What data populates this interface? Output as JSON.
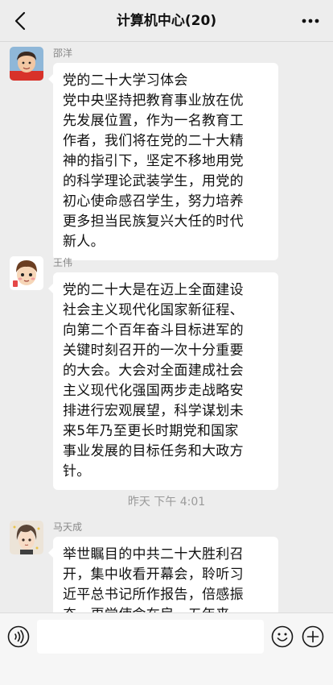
{
  "header": {
    "title": "计算机中心(20)",
    "back_icon": "chevron-left-icon",
    "more_icon": "more-dots-icon"
  },
  "messages": [
    {
      "sender": "邵洋",
      "avatar": "child-photo-avatar",
      "lines": [
        "党的二十大学习体会",
        "党中央坚持把教育事业放在优",
        "先发展位置，作为一名教育工",
        "作者，我们将在党的二十大精",
        "神的指引下，坚定不移地用党",
        "的科学理论武装学生，用党的",
        "初心使命感召学生，努力培养",
        "更多担当民族复兴大任的时代",
        "新人。"
      ]
    },
    {
      "sender": "王伟",
      "avatar": "cartoon-avatar",
      "lines": [
        "党的二十大是在迈上全面建设",
        "社会主义现代化国家新征程、",
        "向第二个百年奋斗目标进军的",
        "关键时刻召开的一次十分重要",
        "的大会。大会对全面建成社会",
        "主义现代化强国两步走战略安",
        "排进行宏观展望，科学谋划未",
        "来5年乃至更长时期党和国家",
        "事业发展的目标任务和大政方",
        "针。"
      ]
    },
    {
      "sender": "马天成",
      "avatar": "anime-portrait-avatar",
      "lines": [
        "举世瞩目的中共二十大胜利召",
        "开，集中收看开幕会，聆听习",
        "近平总书记所作报告，倍感振",
        "奋，更觉使命在肩。五年来"
      ]
    }
  ],
  "timestamp": "昨天 下午 4:01",
  "input_bar": {
    "voice_icon": "voice-icon",
    "emoji_icon": "emoji-icon",
    "plus_icon": "plus-icon"
  }
}
